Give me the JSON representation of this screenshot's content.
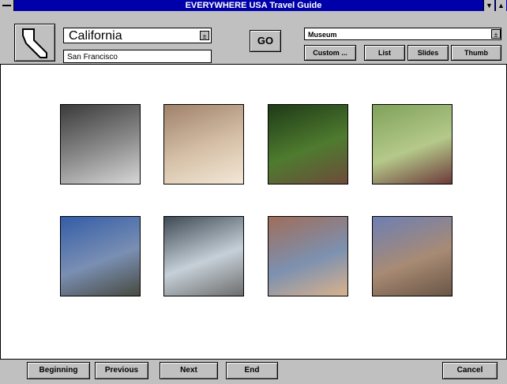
{
  "window": {
    "title": "EVERYWHERE USA Travel Guide"
  },
  "titlebar": {
    "minimize_glyph": "▼",
    "maximize_glyph": "▲"
  },
  "toolbar": {
    "state_value": "California",
    "city_value": "San Francisco",
    "go_label": "GO",
    "category_value": "Museum",
    "dropdown_glyph": "±",
    "buttons": [
      {
        "label": "Custom ..."
      },
      {
        "label": "List"
      },
      {
        "label": "Slides"
      },
      {
        "label": "Thumb"
      }
    ]
  },
  "thumbnails": [
    {
      "subject": "museum-interior-hall",
      "colors": [
        "#3a3a3a",
        "#8c8c8c",
        "#d7d7d7"
      ]
    },
    {
      "subject": "gallery-room",
      "colors": [
        "#a0816a",
        "#d6c1a8",
        "#f3e7d6"
      ]
    },
    {
      "subject": "garden-trees",
      "colors": [
        "#1f3a17",
        "#4e7b2f",
        "#6d4b3b"
      ]
    },
    {
      "subject": "children-running",
      "colors": [
        "#7fa25a",
        "#b5c98a",
        "#6c3a3a"
      ]
    },
    {
      "subject": "building-blue-sky",
      "colors": [
        "#335da8",
        "#7a8fb3",
        "#474a3f"
      ]
    },
    {
      "subject": "building-trees",
      "colors": [
        "#3e4a55",
        "#c6d0d8",
        "#6d6d6d"
      ]
    },
    {
      "subject": "painting-figure",
      "colors": [
        "#a06d5a",
        "#7c91b0",
        "#d9b28d"
      ]
    },
    {
      "subject": "stone-building",
      "colors": [
        "#6d7fb4",
        "#a88b74",
        "#6a5545"
      ]
    }
  ],
  "footer": {
    "buttons": [
      {
        "label": "Beginning"
      },
      {
        "label": "Previous"
      },
      {
        "label": "Next"
      },
      {
        "label": "End"
      },
      {
        "label": "Cancel"
      }
    ]
  }
}
